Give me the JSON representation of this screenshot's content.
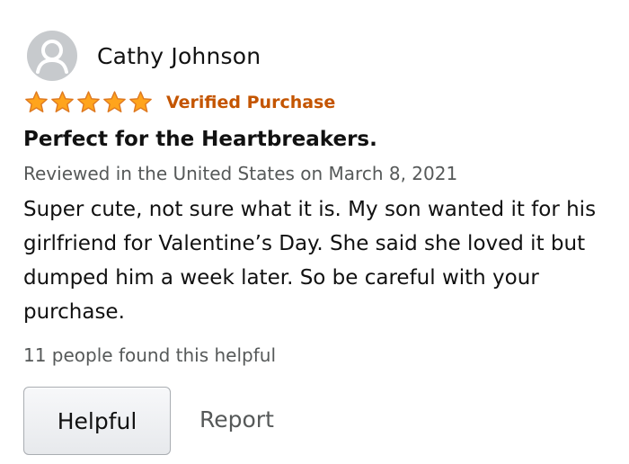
{
  "review": {
    "reviewer_name": "Cathy Johnson",
    "rating_stars": 5,
    "rating_max": 5,
    "verified_label": "Verified Purchase",
    "title": "Perfect for the Heartbreakers.",
    "meta": "Reviewed in the United States on March 8, 2021",
    "body": "Super cute, not sure what it is. My son wanted it for his girlfriend for Valentine’s Day. She said she loved it but dumped him a week later. So be careful with your purchase.",
    "helpful_count_text": "11 people found this helpful"
  },
  "actions": {
    "helpful_label": "Helpful",
    "report_label": "Report"
  },
  "icons": {
    "avatar": "user-avatar-icon",
    "star": "star-icon"
  },
  "colors": {
    "star_fill": "#ffa41c",
    "star_stroke": "#de7921",
    "verified": "#c45500",
    "meta_text": "#565959",
    "avatar_bg": "#c7cacd"
  }
}
